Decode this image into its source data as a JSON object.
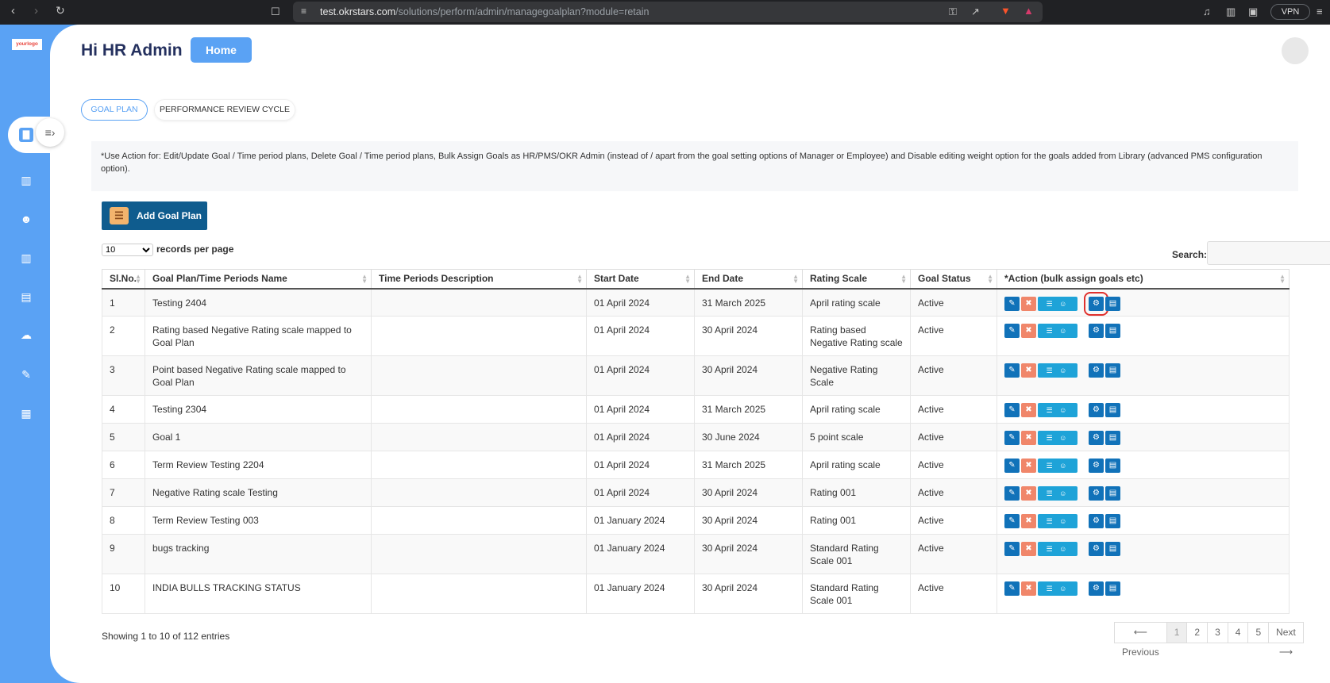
{
  "browser": {
    "url_host": "test.okrstars.com",
    "url_path": "/solutions/perform/admin/managegoalplan?module=retain",
    "vpn_label": "VPN"
  },
  "app": {
    "logo": {
      "pre": "your",
      "post": "logo"
    },
    "greeting": "Hi HR Admin",
    "home_label": "Home",
    "tabs": [
      {
        "label": "GOAL PLAN",
        "active": true
      },
      {
        "label": "PERFORMANCE REVIEW CYCLE",
        "active": false
      }
    ],
    "note": "*Use Action for: Edit/Update Goal / Time period plans, Delete Goal / Time period plans, Bulk Assign Goals as HR/PMS/OKR Admin (instead of / apart from the goal setting options of Manager or Employee) and Disable editing weight option for the goals added from Library (advanced PMS configuration option).",
    "add_button": "Add Goal Plan",
    "records_per_page": {
      "value": "10",
      "label": "records per page"
    },
    "search_label": "Search:",
    "search_value": "",
    "columns": [
      "Sl.No.",
      "Goal Plan/Time Periods Name",
      "Time Periods Description",
      "Start Date",
      "End Date",
      "Rating Scale",
      "Goal Status",
      "*Action (bulk assign goals etc)"
    ],
    "rows": [
      {
        "no": "1",
        "name": "Testing 2404",
        "desc": "",
        "start": "01 April 2024",
        "end": "31 March 2025",
        "scale": "April rating scale",
        "status": "Active"
      },
      {
        "no": "2",
        "name": "Rating based Negative Rating scale mapped to Goal Plan",
        "desc": "",
        "start": "01 April 2024",
        "end": "30 April 2024",
        "scale": "Rating based Negative Rating scale",
        "status": "Active"
      },
      {
        "no": "3",
        "name": "Point based Negative Rating scale mapped to Goal Plan",
        "desc": "",
        "start": "01 April 2024",
        "end": "30 April 2024",
        "scale": "Negative Rating Scale",
        "status": "Active"
      },
      {
        "no": "4",
        "name": "Testing 2304",
        "desc": "",
        "start": "01 April 2024",
        "end": "31 March 2025",
        "scale": "April rating scale",
        "status": "Active"
      },
      {
        "no": "5",
        "name": "Goal 1",
        "desc": "",
        "start": "01 April 2024",
        "end": "30 June 2024",
        "scale": "5 point scale",
        "status": "Active"
      },
      {
        "no": "6",
        "name": "Term Review Testing 2204",
        "desc": "",
        "start": "01 April 2024",
        "end": "31 March 2025",
        "scale": "April rating scale",
        "status": "Active"
      },
      {
        "no": "7",
        "name": "Negative Rating scale Testing",
        "desc": "",
        "start": "01 April 2024",
        "end": "30 April 2024",
        "scale": "Rating 001",
        "status": "Active"
      },
      {
        "no": "8",
        "name": "Term Review Testing 003",
        "desc": "",
        "start": "01 January 2024",
        "end": "30 April 2024",
        "scale": "Rating 001",
        "status": "Active"
      },
      {
        "no": "9",
        "name": "bugs tracking",
        "desc": "",
        "start": "01 January 2024",
        "end": "30 April 2024",
        "scale": "Standard Rating Scale 001",
        "status": "Active"
      },
      {
        "no": "10",
        "name": "INDIA BULLS TRACKING STATUS",
        "desc": "",
        "start": "01 January 2024",
        "end": "30 April 2024",
        "scale": "Standard Rating Scale 001",
        "status": "Active"
      }
    ],
    "showing": "Showing 1 to 10 of 112 entries",
    "pagination": {
      "prev": "⟵ Previous",
      "pages": [
        "1",
        "2",
        "3",
        "4",
        "5"
      ],
      "current": "1",
      "next": "Next ⟶"
    },
    "icons": {
      "edit": "✎",
      "delete": "✖",
      "assign": "☰ ☺",
      "settings": "⚙",
      "document": "▤"
    }
  }
}
